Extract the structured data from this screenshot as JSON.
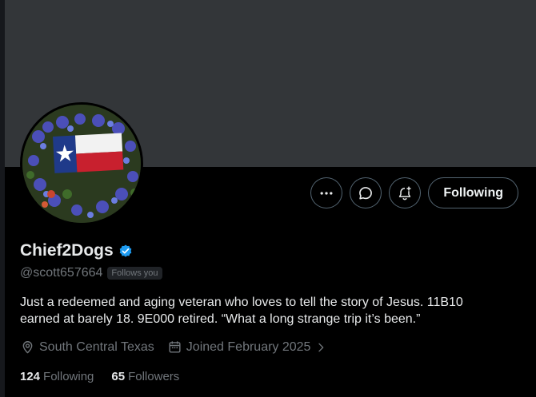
{
  "profile": {
    "display_name": "Chief2Dogs",
    "handle": "@scott657664",
    "follows_you_badge": "Follows you",
    "bio_line1": "Just a redeemed and aging veteran who loves to tell the story of Jesus.  11B10",
    "bio_line2": "earned at barely 18.  9E000 retired.  “What a long strange trip it’s been.”",
    "location": "South Central Texas",
    "joined": "Joined February 2025",
    "following_count": "124",
    "following_label": "Following",
    "followers_count": "65",
    "followers_label": "Followers"
  },
  "actions": {
    "follow_button_label": "Following"
  },
  "icons": {
    "more": "more-horizontal-icon",
    "message": "message-bubble-icon",
    "notify": "bell-plus-icon",
    "verified": "verified-badge-icon",
    "location": "location-pin-icon",
    "calendar": "calendar-icon",
    "chevron": "chevron-right-icon"
  },
  "colors": {
    "background": "#000000",
    "banner": "#333639",
    "muted_text": "#71767b",
    "verified_blue": "#1d9bf0",
    "border": "#536471"
  }
}
